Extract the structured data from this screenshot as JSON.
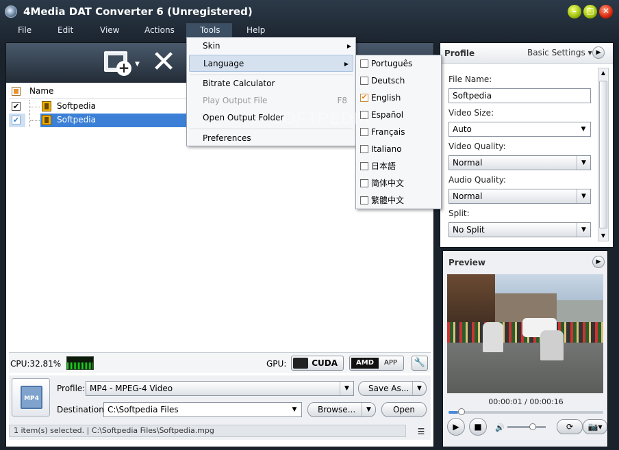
{
  "window": {
    "title": "4Media DAT Converter 6 (Unregistered)"
  },
  "menubar": [
    "File",
    "Edit",
    "View",
    "Actions",
    "Tools",
    "Help"
  ],
  "file_list": {
    "header_name": "Name",
    "rows": [
      {
        "name": "Softpedia",
        "checked": true,
        "selected": false
      },
      {
        "name": "Softpedia",
        "checked": true,
        "selected": true
      }
    ]
  },
  "statusbar": {
    "cpu": "CPU:32.81%",
    "gpu": "GPU:",
    "cuda": "CUDA",
    "amd": "AMD",
    "amd_app": "APP"
  },
  "profile_bar": {
    "profile_label": "Profile:",
    "profile_value": "MP4 - MPEG-4 Video",
    "save_as": "Save As...",
    "destination_label": "Destination:",
    "destination_value": "C:\\Softpedia Files",
    "browse": "Browse...",
    "open": "Open",
    "mp4_badge": "MP4"
  },
  "status_line": "1 item(s) selected. | C:\\Softpedia Files\\Softpedia.mpg",
  "profile_panel": {
    "title": "Profile",
    "basic_settings": "Basic Settings",
    "file_name_label": "File Name:",
    "file_name_value": "Softpedia",
    "video_size_label": "Video Size:",
    "video_size_value": "Auto",
    "video_quality_label": "Video Quality:",
    "video_quality_value": "Normal",
    "audio_quality_label": "Audio Quality:",
    "audio_quality_value": "Normal",
    "split_label": "Split:",
    "split_value": "No Split"
  },
  "preview": {
    "title": "Preview",
    "time": "00:00:01 / 00:00:16",
    "progress": 0.0625
  },
  "tools_menu": {
    "items": [
      {
        "label": "Skin",
        "submenu": true
      },
      {
        "label": "Language",
        "submenu": true,
        "highlighted": true
      },
      {
        "label": "Bitrate Calculator"
      },
      {
        "label": "Play Output File",
        "shortcut": "F8",
        "disabled": true
      },
      {
        "label": "Open Output Folder"
      },
      {
        "label": "Preferences"
      }
    ]
  },
  "language_menu": [
    {
      "label": "Português",
      "checked": false
    },
    {
      "label": "Deutsch",
      "checked": false
    },
    {
      "label": "English",
      "checked": true
    },
    {
      "label": "Español",
      "checked": false
    },
    {
      "label": "Français",
      "checked": false
    },
    {
      "label": "Italiano",
      "checked": false
    },
    {
      "label": "日本語",
      "checked": false
    },
    {
      "label": "简体中文",
      "checked": false
    },
    {
      "label": "繁體中文",
      "checked": false
    }
  ],
  "watermark": "SOFTPEDIA"
}
